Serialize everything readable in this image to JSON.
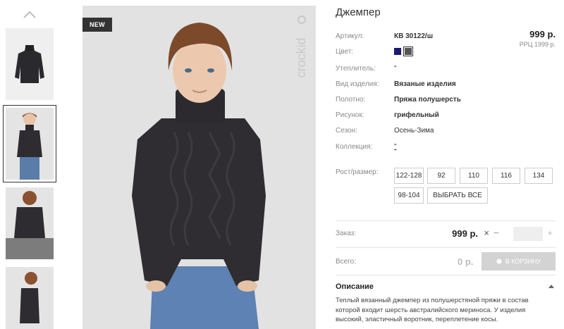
{
  "gallery": {
    "thumbnails": [
      {
        "label": "thumbnail-1"
      },
      {
        "label": "thumbnail-2"
      },
      {
        "label": "thumbnail-3"
      },
      {
        "label": "thumbnail-4"
      }
    ],
    "badge": "NEW",
    "brand_watermark": "crockid"
  },
  "product": {
    "title": "Джемпер",
    "price": "999 р.",
    "rrp": "РРЦ 1999 р.",
    "attributes": [
      {
        "label": "Артикул:",
        "value": "КВ 30122/ш",
        "bold": true
      },
      {
        "label": "Цвет:",
        "value": "",
        "bold": false
      },
      {
        "label": "Утеплитель:",
        "value": "\"",
        "bold": false
      },
      {
        "label": "Вид изделия:",
        "value": "Вязаные изделия",
        "bold": true
      },
      {
        "label": "Полотно:",
        "value": "Пряжа полушерсть",
        "bold": true
      },
      {
        "label": "Рисунок:",
        "value": "грифельный",
        "bold": true
      },
      {
        "label": "Сезон:",
        "value": "Осень-Зима",
        "bold": false
      },
      {
        "label": "Коллекция:",
        "value": "\"",
        "bold": false
      }
    ],
    "colors": [
      "#1a1a6e",
      "#555555"
    ]
  },
  "sizes": {
    "label": "Рост/размер:",
    "options": [
      "122-128",
      "92",
      "110",
      "116",
      "134",
      "98-104"
    ],
    "select_all": "ВЫБРАТЬ ВСЕ"
  },
  "order": {
    "label": "Заказ:",
    "price": "999 р.",
    "times": "×",
    "minus": "−",
    "plus": "+",
    "qty": ""
  },
  "total": {
    "label": "Всего:",
    "price": "0 р.",
    "cart_button": "В КОРЗИНУ"
  },
  "description": {
    "title": "Описание",
    "text": "Теплый вязанный джемпер из полушерстяной пряжи в состав которой входит шерсть австралийского мериноса. У изделия высокий, эластичный воротник, переплетение косы."
  }
}
